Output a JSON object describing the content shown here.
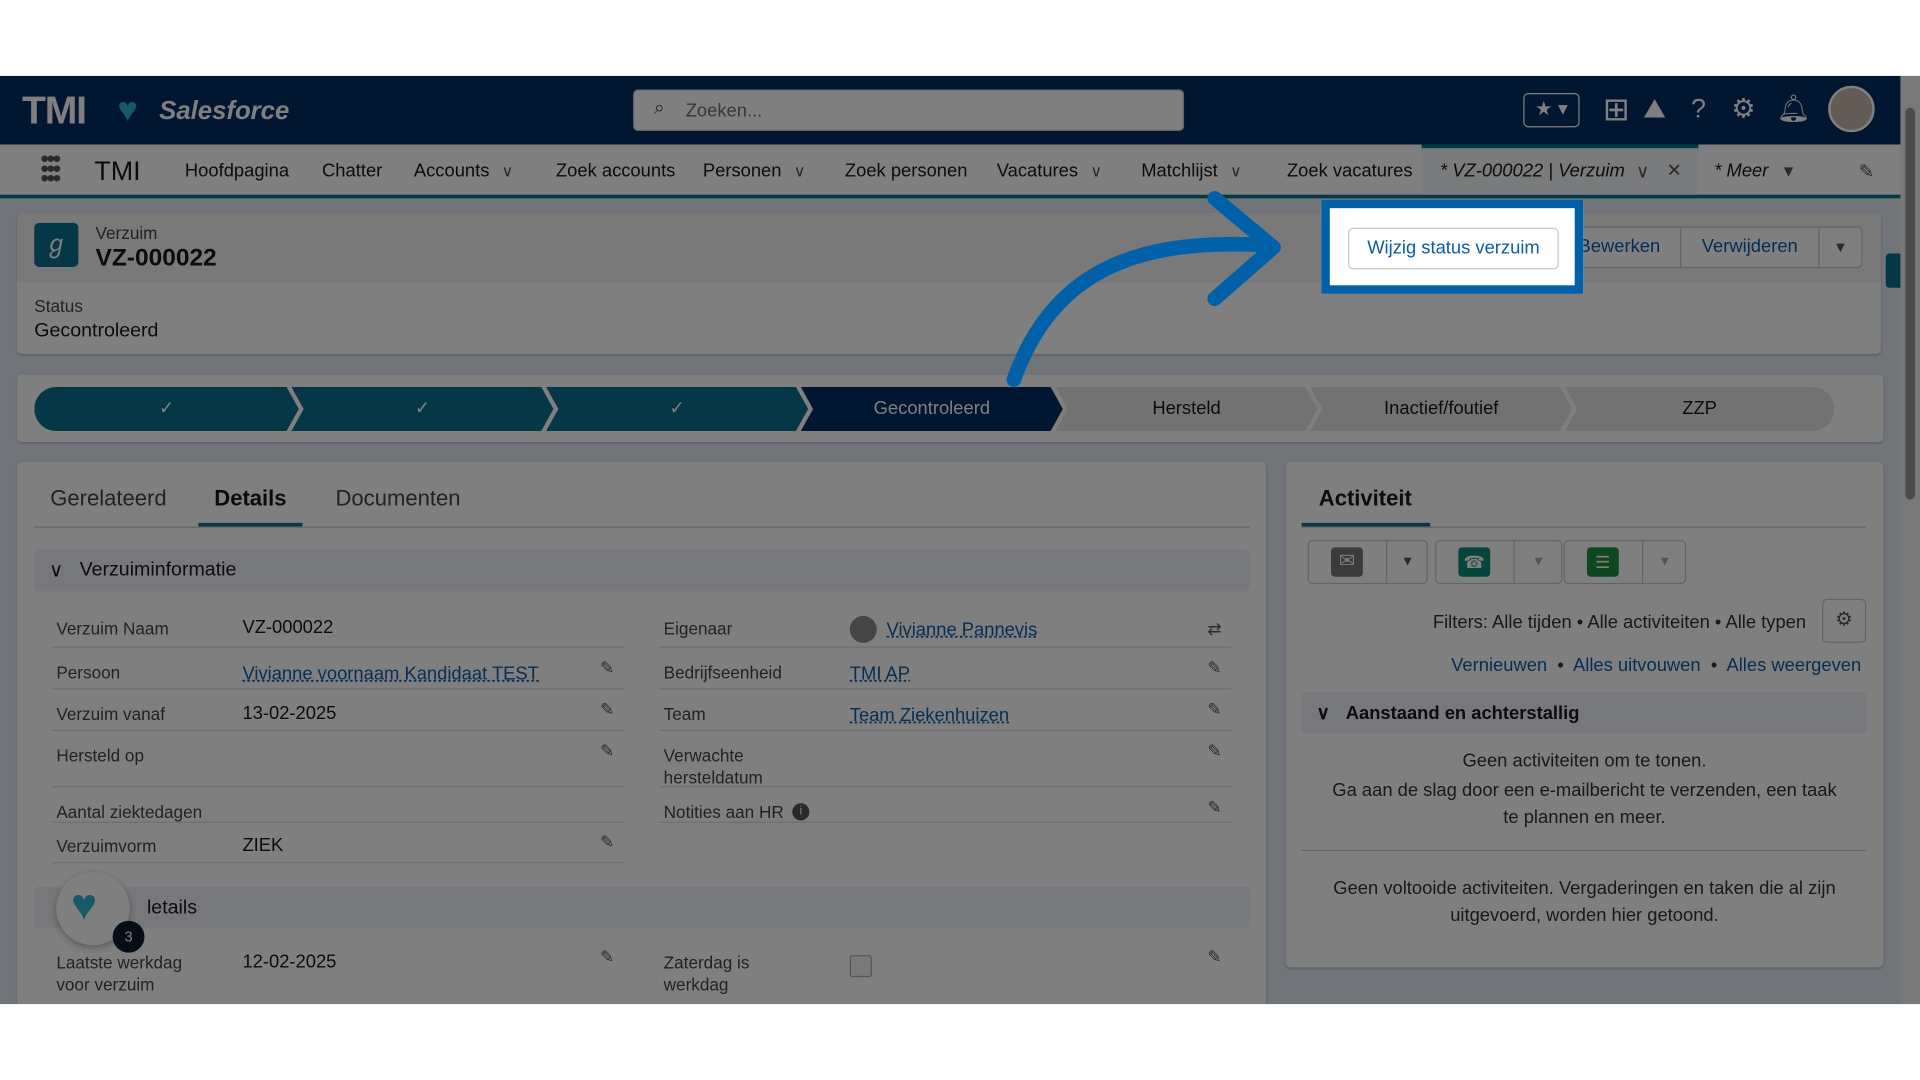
{
  "header": {
    "logo": "TMI",
    "brand": "Salesforce",
    "search_placeholder": "Zoeken..."
  },
  "nav": {
    "app": "TMI",
    "items": [
      {
        "label": "Hoofdpagina"
      },
      {
        "label": "Chatter"
      },
      {
        "label": "Accounts",
        "dropdown": true
      },
      {
        "label": "Zoek accounts"
      },
      {
        "label": "Personen",
        "dropdown": true
      },
      {
        "label": "Zoek personen"
      },
      {
        "label": "Vacatures",
        "dropdown": true
      },
      {
        "label": "Matchlijst",
        "dropdown": true
      },
      {
        "label": "Zoek vacatures"
      }
    ],
    "active_tab": "* VZ-000022 | Verzuim",
    "more": "* Meer"
  },
  "record": {
    "object": "Verzuim",
    "name": "VZ-000022",
    "status_label": "Status",
    "status_value": "Gecontroleerd",
    "buttons": {
      "primary": "Wijzig status verzuim",
      "edit": "Bewerken",
      "delete": "Verwijderen"
    }
  },
  "path": {
    "steps": [
      "✓",
      "✓",
      "✓",
      "Gecontroleerd",
      "Hersteld",
      "Inactief/foutief",
      "ZZP"
    ],
    "current": "Gecontroleerd"
  },
  "tabs": [
    "Gerelateerd",
    "Details",
    "Documenten"
  ],
  "active_tab": "Details",
  "sections": {
    "s1": "Verzuiminformatie",
    "s2": "letails"
  },
  "fields": {
    "verzuim_naam": {
      "label": "Verzuim Naam",
      "value": "VZ-000022"
    },
    "persoon": {
      "label": "Persoon",
      "value": "Vivianne voornaam Kandidaat TEST"
    },
    "verzuim_vanaf": {
      "label": "Verzuim vanaf",
      "value": "13-02-2025"
    },
    "hersteld_op": {
      "label": "Hersteld op",
      "value": ""
    },
    "aantal": {
      "label": "Aantal ziektedagen",
      "value": ""
    },
    "verzuimvorm": {
      "label": "Verzuimvorm",
      "value": "ZIEK"
    },
    "eigenaar": {
      "label": "Eigenaar",
      "value": "Vivianne Pannevis"
    },
    "bedrijfseenheid": {
      "label": "Bedrijfseenheid",
      "value": "TMI AP"
    },
    "team": {
      "label": "Team",
      "value": "Team Ziekenhuizen"
    },
    "verwachte": {
      "label1": "Verwachte",
      "label2": "hersteldatum",
      "value": ""
    },
    "notities": {
      "label": "Notities aan HR",
      "value": ""
    },
    "laatste": {
      "label1": "Laatste werkdag",
      "label2": "voor verzuim",
      "value": "12-02-2025"
    },
    "zaterdag": {
      "label1": "Zaterdag is",
      "label2": "werkdag",
      "checked": false
    }
  },
  "activity": {
    "title": "Activiteit",
    "filters": "Filters: Alle tijden • Alle activiteiten • Alle typen",
    "links": [
      "Vernieuwen",
      "Alles uitvouwen",
      "Alles weergeven"
    ],
    "section": "Aanstaand en achterstallig",
    "empty1": "Geen activiteiten om te tonen.",
    "empty2": "Ga aan de slag door een e-mailbericht te verzenden, een taak te plannen en meer.",
    "empty3": "Geen voltooide activiteiten. Vergaderingen en taken die al zijn uitgevoerd, worden hier getoond."
  },
  "widget": {
    "badge": "3"
  },
  "colors": {
    "navy": "#032d60",
    "path_done": "#0b6f8e",
    "path_current": "#032d60",
    "highlight": "#0061a8"
  }
}
